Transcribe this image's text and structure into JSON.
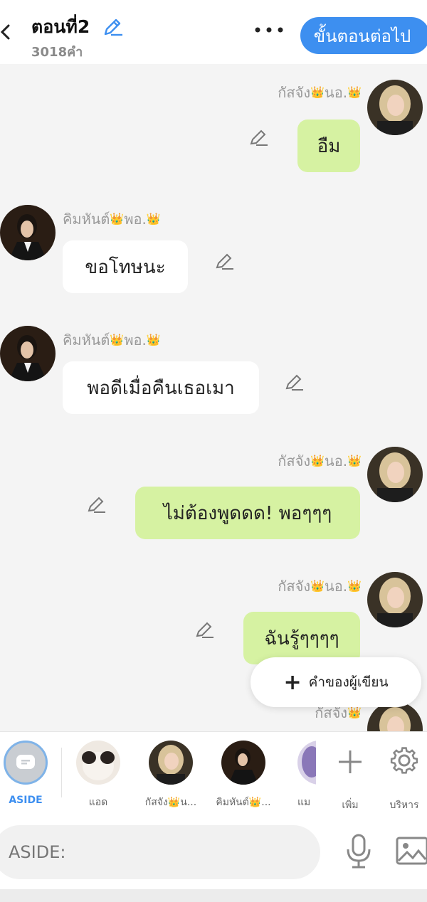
{
  "header": {
    "title": "ตอนที่2",
    "word_count": "3018คำ",
    "next_label": "ขั้นตอนต่อไป"
  },
  "messages": [
    {
      "side": "right",
      "name_a": "กัสจัง",
      "name_b": "นอ.",
      "text": "อืม"
    },
    {
      "side": "left",
      "name_a": "คิมหันต์",
      "name_b": "พอ.",
      "text": "ขอโทษนะ"
    },
    {
      "side": "left",
      "name_a": "คิมหันต์",
      "name_b": "พอ.",
      "text": "พอดีเมื่อคืนเธอเมา"
    },
    {
      "side": "right",
      "name_a": "กัสจัง",
      "name_b": "นอ.",
      "text": "ไม่ต้องพูดดด!  พอๆๆๆ"
    },
    {
      "side": "right",
      "name_a": "กัสจัง",
      "name_b": "นอ.",
      "text": "ฉันรู้ๆๆๆๆ"
    }
  ],
  "partial_name": "กัสจัง",
  "fab_label": "คำของผู้เขียน",
  "characters": {
    "aside": "ASIDE",
    "c1": "แอด",
    "c2": "กัสจัง👑น...",
    "c3": "คิมหันต์👑...",
    "c4": "แม",
    "add": "เพิ่ม",
    "manage": "บริหาร"
  },
  "input": {
    "placeholder": "ASIDE:"
  },
  "colors": {
    "accent": "#3d8ff0",
    "right_bubble": "#d6f2a2",
    "left_bubble": "#ffffff"
  }
}
